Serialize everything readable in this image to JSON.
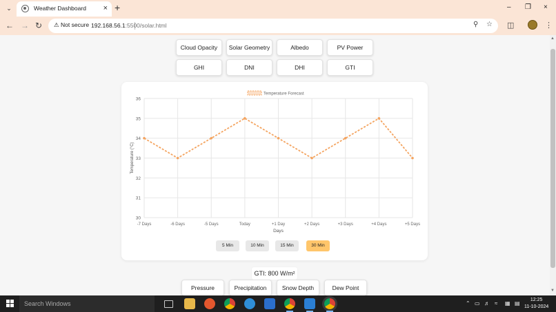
{
  "browser": {
    "tab_title": "Weather Dashboard",
    "security_label": "Not secure",
    "url_host": "192.168.56.1",
    "url_path": ":5500/solar.html"
  },
  "nav_buttons": {
    "row1": [
      "Cloud Opacity",
      "Solar Geometry",
      "Albedo",
      "PV Power"
    ],
    "row2": [
      "GHI",
      "DNI",
      "DHI",
      "GTI"
    ]
  },
  "time_buttons": [
    "5 Min",
    "10 Min",
    "15 Min",
    "30 Min"
  ],
  "active_time_button": "30 Min",
  "gti_value": "GTI: 800 W/m²",
  "bottom_buttons": [
    "Pressure",
    "Precipitation",
    "Snow Depth",
    "Dew Point"
  ],
  "chart_data": {
    "type": "line",
    "legend": "Temperature Forecast",
    "xlabel": "Days",
    "ylabel": "Temperature (°C)",
    "categories": [
      "-7 Days",
      "-6 Days",
      "-5 Days",
      "Today",
      "+1 Day",
      "+2 Days",
      "+3 Days",
      "+4 Days",
      "+5 Days"
    ],
    "series": [
      {
        "name": "Temperature Forecast",
        "values": [
          34,
          33,
          34,
          35,
          34,
          33,
          34,
          35,
          33
        ]
      }
    ],
    "ylim": [
      30,
      36
    ],
    "yticks": [
      30,
      31,
      32,
      33,
      34,
      35,
      36
    ],
    "line_color": "#f4a460",
    "line_style": "dashed",
    "grid": true,
    "legend_position": "top-center"
  },
  "taskbar": {
    "search_placeholder": "Search Windows",
    "time": "12:25",
    "date": "11-10-2024"
  },
  "colors": {
    "chrome_frame": "#fbe5d6",
    "active_button": "#ffc66b",
    "taskbar": "#1f1f1f"
  }
}
